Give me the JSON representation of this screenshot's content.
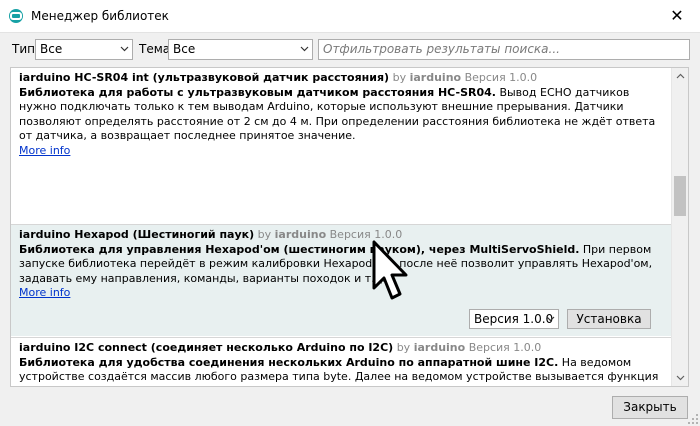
{
  "window": {
    "title": "Менеджер библиотек",
    "close_glyph": "✕"
  },
  "filters": {
    "type_label": "Тип",
    "type_value": "Все",
    "topic_label": "Тема",
    "topic_value": "Все",
    "search_placeholder": "Отфильтровать результаты поиска..."
  },
  "libraries": [
    {
      "name": "iarduino HC-SR04 int (ультразвуковой датчик расстояния)",
      "by": "by",
      "author": "iarduino",
      "version_text": "Версия 1.0.0",
      "summary": "Библиотека для работы с ультразвуковым датчиком расстояния HC-SR04.",
      "description": "Вывод ECHO датчиков нужно подключать только к тем выводам Arduino, которые используют внешние прерывания. Датчики позволяют определять расстояние от 2 см до 4 м. При определении расстояния библиотека не ждёт ответа от датчика, а возвращает последнее принятое значение.",
      "more_info": "More info"
    },
    {
      "name": "iarduino Hexapod (Шестиногий паук)",
      "by": "by",
      "author": "iarduino",
      "version_text": "Версия 1.0.0",
      "summary": "Библиотека для управления Hexapod'ом (шестиногим пауком), через MultiServoShield.",
      "description": "При первом запуске библиотека перейдёт в режим калибровки Hexapod'а, а после неё позволит управлять Hexapod'ом, задавать ему направления, команды, варианты походок и т.д.",
      "more_info": "More info",
      "selected_version": "Версия 1.0.0",
      "install_label": "Установка"
    },
    {
      "name": "iarduino I2C connect (соединяет несколько Arduino по I2C)",
      "by": "by",
      "author": "iarduino",
      "version_text": "Версия 1.0.0",
      "summary": "Библиотека для удобства соединения нескольких Arduino по аппаратной шине I2C.",
      "description": "На ведомом устройстве создаётся массив любого размера типа byte. Далее на ведомом устройстве вызывается функция begin(адрес); библиотеки Wire и вызывается функция begin(массив); библиотеки iarduino_I2C_connect, где аргумент «адрес» - это назначаемый Вами адрес для ведомого на шине I2C, а аргумент «массив» это имя созданного массива к которому разрешается обращаться мастеру. Мастер может читать и записывать значения элементов массива, по"
    }
  ],
  "footer": {
    "close_label": "Закрыть"
  },
  "icons": {
    "app": "arduino-logo-icon",
    "chevron": "chevron-down-icon",
    "cursor": "mouse-pointer-icon"
  },
  "colors": {
    "app_icon": "#17a1a5",
    "link": "#0033cc",
    "selected_row": "#e8f0f0",
    "window_bg": "#f0f0f0"
  }
}
